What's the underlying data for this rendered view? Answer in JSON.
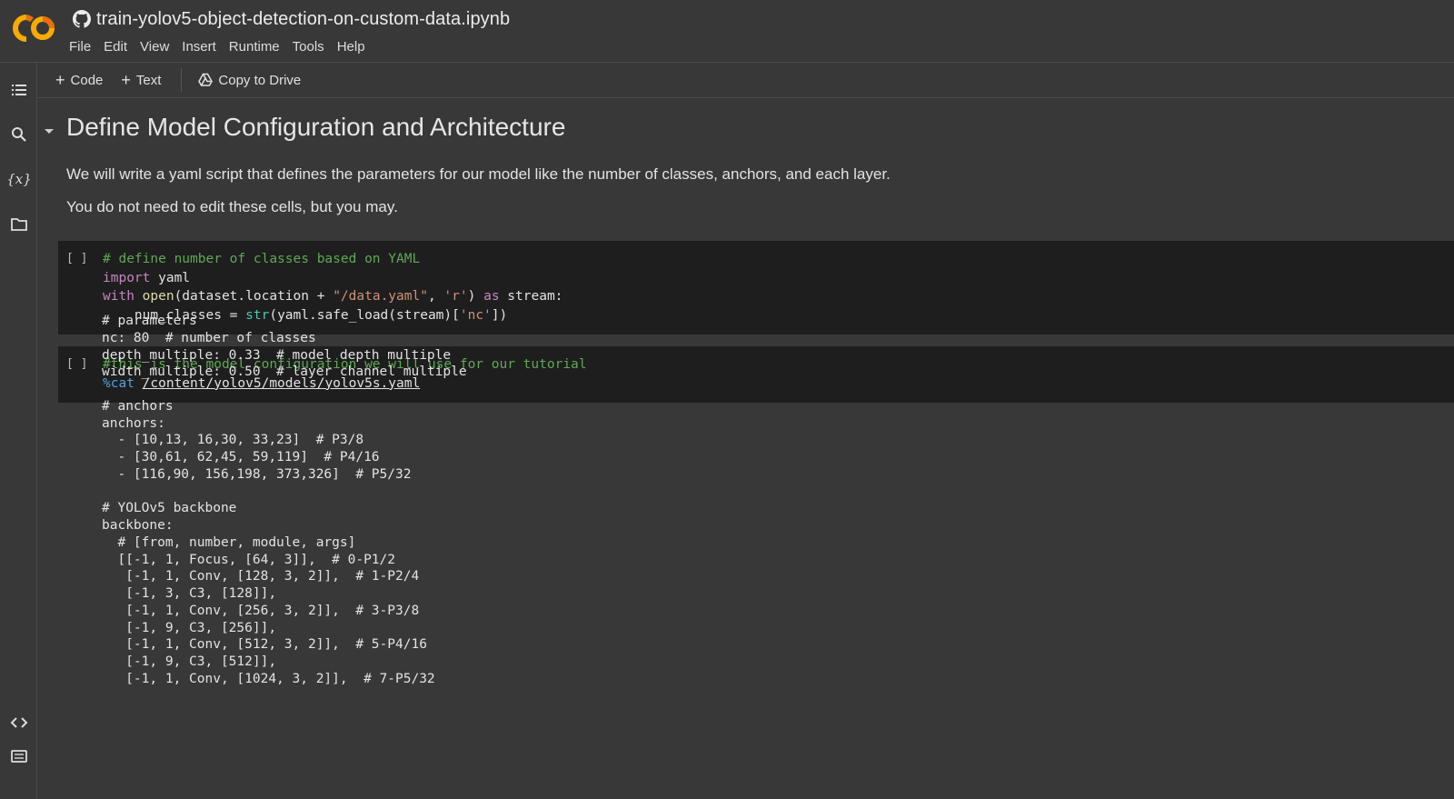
{
  "header": {
    "notebook_title": "train-yolov5-object-detection-on-custom-data.ipynb",
    "menu": [
      "File",
      "Edit",
      "View",
      "Insert",
      "Runtime",
      "Tools",
      "Help"
    ]
  },
  "rail": {
    "icons": [
      "table-of-contents-icon",
      "search-icon",
      "variables-icon",
      "files-icon",
      "code-snippets-icon",
      "command-palette-icon"
    ],
    "variables_glyph": "{x}"
  },
  "toolbar": {
    "code_label": "Code",
    "text_label": "Text",
    "copy_label": "Copy to Drive"
  },
  "section": {
    "title": "Define Model Configuration and Architecture",
    "paragraph1": "We will write a yaml script that defines the parameters for our model like the number of classes, anchors, and each layer.",
    "paragraph2": "You do not need to edit these cells, but you may."
  },
  "cells": [
    {
      "run_label": "[ ]",
      "lines": [
        [
          {
            "t": "# define number of classes based on YAML",
            "c": "cm"
          }
        ],
        [
          {
            "t": "import",
            "c": "kw"
          },
          {
            "t": " yaml",
            "c": ""
          }
        ],
        [
          {
            "t": "with",
            "c": "kw"
          },
          {
            "t": " ",
            "c": ""
          },
          {
            "t": "open",
            "c": "fn"
          },
          {
            "t": "(dataset.location + ",
            "c": ""
          },
          {
            "t": "\"/data.yaml\"",
            "c": "st"
          },
          {
            "t": ", ",
            "c": ""
          },
          {
            "t": "'r'",
            "c": "st"
          },
          {
            "t": ") ",
            "c": ""
          },
          {
            "t": "as",
            "c": "kw"
          },
          {
            "t": " stream:",
            "c": ""
          }
        ],
        [
          {
            "t": "    num_classes = ",
            "c": ""
          },
          {
            "t": "str",
            "c": "bi"
          },
          {
            "t": "(yaml.safe_load(stream)[",
            "c": ""
          },
          {
            "t": "'nc'",
            "c": "st"
          },
          {
            "t": "])",
            "c": ""
          }
        ]
      ]
    },
    {
      "run_label": "[ ]",
      "lines": [
        [
          {
            "t": "#this is the model configuration we will use for our tutorial",
            "c": "cm"
          }
        ],
        [
          {
            "t": "%cat",
            "c": "mg"
          },
          {
            "t": " ",
            "c": ""
          },
          {
            "t": "/content/yolov5/models/yolov5s.yaml",
            "c": "ul"
          }
        ]
      ]
    }
  ],
  "output": [
    "# parameters",
    "nc: 80  # number of classes",
    "depth_multiple: 0.33  # model depth multiple",
    "width_multiple: 0.50  # layer channel multiple",
    "",
    "# anchors",
    "anchors:",
    "  - [10,13, 16,30, 33,23]  # P3/8",
    "  - [30,61, 62,45, 59,119]  # P4/16",
    "  - [116,90, 156,198, 373,326]  # P5/32",
    "",
    "# YOLOv5 backbone",
    "backbone:",
    "  # [from, number, module, args]",
    "  [[-1, 1, Focus, [64, 3]],  # 0-P1/2",
    "   [-1, 1, Conv, [128, 3, 2]],  # 1-P2/4",
    "   [-1, 3, C3, [128]],",
    "   [-1, 1, Conv, [256, 3, 2]],  # 3-P3/8",
    "   [-1, 9, C3, [256]],",
    "   [-1, 1, Conv, [512, 3, 2]],  # 5-P4/16",
    "   [-1, 9, C3, [512]],",
    "   [-1, 1, Conv, [1024, 3, 2]],  # 7-P5/32"
  ],
  "colors": {
    "background": "#383838",
    "code_cell": "#1e1e1e",
    "logo_orange": "#f9ab00",
    "logo_dark_orange": "#e8710a",
    "comment": "#5fa855",
    "keyword": "#c586c0",
    "string": "#ce9178"
  }
}
